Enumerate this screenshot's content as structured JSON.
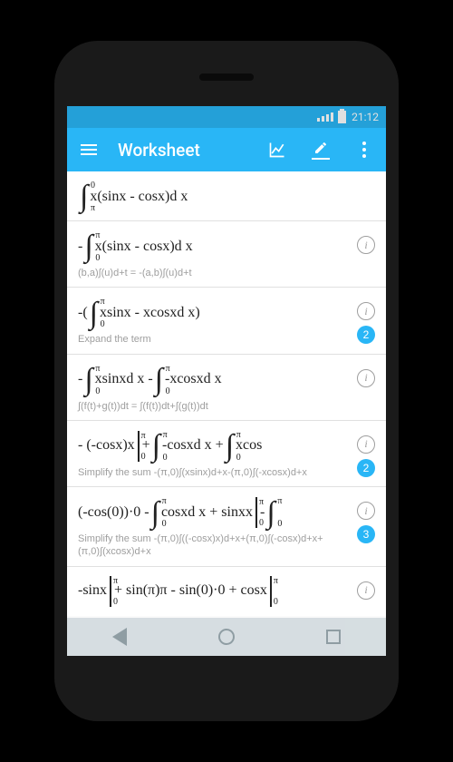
{
  "status": {
    "time": "21:12"
  },
  "appbar": {
    "title": "Worksheet"
  },
  "rows": [
    {
      "expr_pre": "",
      "int_up": "0",
      "int_lo": "π",
      "expr_post": "x(sinx - cosx)d x",
      "note": "",
      "info": false,
      "badge": ""
    },
    {
      "expr_pre": "-",
      "int_up": "π",
      "int_lo": "0",
      "expr_post": "x(sinx - cosx)d x",
      "note": "(b,a)∫(u)d+t = -(a,b)∫(u)d+t",
      "info": true,
      "badge": ""
    },
    {
      "expr_pre": "-(",
      "int_up": "π",
      "int_lo": "0",
      "expr_post": "xsinx - xcosxd x)",
      "note": "Expand the term",
      "info": true,
      "badge": "2"
    },
    {
      "expr_pre": "-",
      "int_up": "π",
      "int_lo": "0",
      "expr_post": "xsinxd x - ",
      "int2_up": "π",
      "int2_lo": "0",
      "expr_post2": "-xcosxd x",
      "note": "∫(f(t)+g(t))dt = ∫(f(t))dt+∫(g(t))dt",
      "info": true,
      "badge": ""
    },
    {
      "expr_pre": "- (-cosx)x",
      "vbar_up": "π",
      "vbar_lo": "0",
      "mid": "+ ",
      "int_up": "π",
      "int_lo": "0",
      "expr_post": "-cosxd x + ",
      "int2_up": "π",
      "int2_lo": "0",
      "expr_post2": "xcos",
      "note": "Simplify the sum -(π,0)∫(xsinx)d+x-(π,0)∫(-xcosx)d+x",
      "info": true,
      "badge": "2"
    },
    {
      "expr_pre": "(-cos(0))·0 - ",
      "int_up": "π",
      "int_lo": "0",
      "expr_post": "cosxd x +  sinxx",
      "vbar_up": "π",
      "vbar_lo": "0",
      "mid": "- ",
      "int2_up": "π",
      "int2_lo": "0",
      "expr_post2": "",
      "note": "Simplify the sum -(π,0)∫((-cosx)x)d+x+(π,0)∫(-cosx)d+x+(π,0)∫(xcosx)d+x",
      "info": true,
      "badge": "3"
    },
    {
      "expr_pre": " -sinx",
      "vbar_up": "π",
      "vbar_lo": "0",
      "mid": " + sin(π)π - sin(0)·0 +  cosx",
      "vbar2_up": "π",
      "vbar2_lo": "0",
      "note": "",
      "info": true,
      "badge": ""
    }
  ],
  "info_glyph": "i"
}
